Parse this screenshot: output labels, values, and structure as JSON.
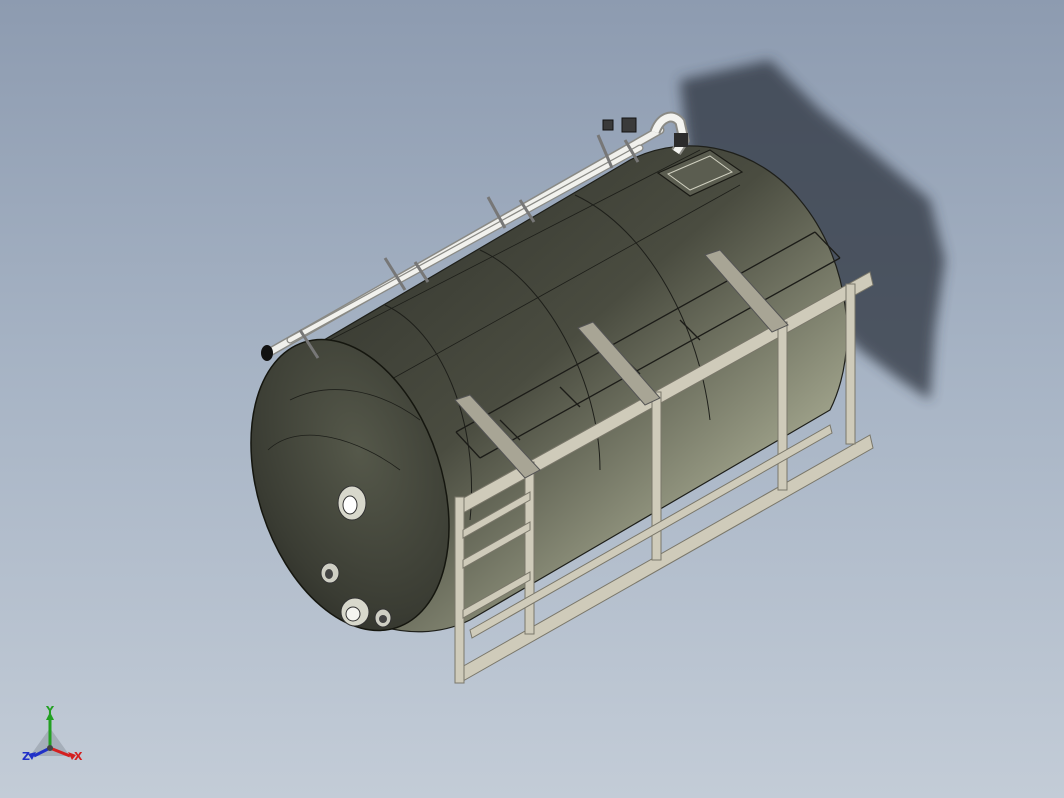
{
  "viewport": {
    "background_top": "#8d9bb0",
    "background_bottom": "#c3ccd7"
  },
  "model": {
    "tank_body_color": "#3b3d33",
    "tank_highlight_color": "#d9dcc6",
    "frame_color": "#cbc7b6",
    "pipe_color": "#e8e8e4",
    "shadow_color": "#2f3540"
  },
  "triad": {
    "x_label": "X",
    "y_label": "Y",
    "z_label": "Z",
    "x_color": "#d42020",
    "y_color": "#22a022",
    "z_color": "#2030c8"
  }
}
